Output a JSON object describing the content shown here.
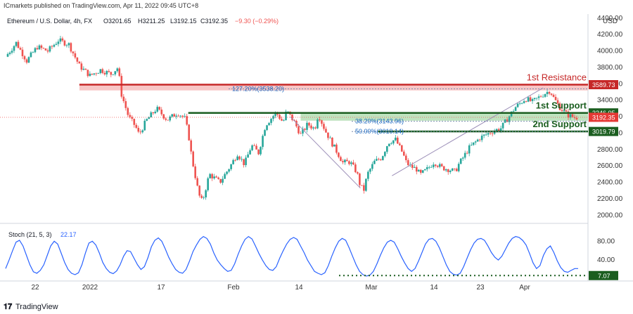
{
  "header": {
    "publisher": "ICmarkets published on TradingView.com, Apr 11, 2022 09:45 UTC+8",
    "symbol": "Ethereum / U.S. Dollar, 4h, FX",
    "open": "O3201.65",
    "high": "H3211.25",
    "low": "L3192.15",
    "close": "C3192.35",
    "change": "−9.30 (−0.29%)"
  },
  "footer": {
    "brand": "TradingView"
  },
  "chart_data": [
    {
      "type": "candlestick",
      "symbol": "Ethereum / U.S. Dollar",
      "interval": "4h",
      "currency": "USD",
      "ylim": [
        1900,
        4450
      ],
      "y_ticks": [
        "4400.00",
        "4200.00",
        "4000.00",
        "3800.00",
        "3600.00",
        "3400.00",
        "3200.00",
        "3000.00",
        "2800.00",
        "2600.00",
        "2400.00",
        "2200.00",
        "2000.00"
      ],
      "x_ticks": [
        "22",
        "2022",
        "17",
        "Feb",
        "14",
        "Mar",
        "14",
        "23",
        "Apr"
      ],
      "price_path": [
        [
          0,
          3930
        ],
        [
          3,
          4100
        ],
        [
          6,
          3880
        ],
        [
          9,
          4050
        ],
        [
          12,
          4000
        ],
        [
          15,
          4130
        ],
        [
          18,
          4080
        ],
        [
          21,
          3820
        ],
        [
          24,
          3700
        ],
        [
          27,
          3770
        ],
        [
          30,
          3720
        ],
        [
          32,
          3800
        ],
        [
          33,
          3470
        ],
        [
          35,
          3200
        ],
        [
          37,
          3080
        ],
        [
          38,
          2980
        ],
        [
          40,
          3150
        ],
        [
          43,
          3300
        ],
        [
          46,
          3160
        ],
        [
          49,
          3250
        ],
        [
          51,
          3180
        ],
        [
          52,
          3000
        ],
        [
          53,
          2700
        ],
        [
          55,
          2250
        ],
        [
          56,
          2160
        ],
        [
          58,
          2500
        ],
        [
          61,
          2400
        ],
        [
          64,
          2600
        ],
        [
          66,
          2750
        ],
        [
          68,
          2620
        ],
        [
          70,
          2850
        ],
        [
          72,
          2760
        ],
        [
          74,
          3100
        ],
        [
          77,
          3250
        ],
        [
          79,
          3130
        ],
        [
          80,
          3270
        ],
        [
          82,
          3150
        ],
        [
          84,
          2980
        ],
        [
          86,
          3110
        ],
        [
          88,
          3050
        ],
        [
          89,
          3230
        ],
        [
          91,
          3030
        ],
        [
          93,
          2870
        ],
        [
          95,
          2720
        ],
        [
          96,
          2640
        ],
        [
          98,
          2650
        ],
        [
          100,
          2520
        ],
        [
          101,
          2350
        ],
        [
          102,
          2310
        ],
        [
          103,
          2500
        ],
        [
          105,
          2650
        ],
        [
          107,
          2700
        ],
        [
          109,
          2890
        ],
        [
          111,
          2920
        ],
        [
          113,
          2760
        ],
        [
          114,
          2650
        ],
        [
          115,
          2600
        ],
        [
          117,
          2560
        ],
        [
          118,
          2490
        ],
        [
          120,
          2560
        ],
        [
          122,
          2650
        ],
        [
          124,
          2580
        ],
        [
          126,
          2560
        ],
        [
          128,
          2530
        ],
        [
          129,
          2620
        ],
        [
          132,
          2820
        ],
        [
          135,
          2940
        ],
        [
          138,
          3010
        ],
        [
          141,
          3060
        ],
        [
          143,
          3180
        ],
        [
          145,
          3310
        ],
        [
          148,
          3420
        ],
        [
          150,
          3380
        ],
        [
          153,
          3470
        ],
        [
          155,
          3520
        ],
        [
          156,
          3430
        ],
        [
          158,
          3300
        ],
        [
          160,
          3220
        ],
        [
          162,
          3190
        ],
        [
          163,
          3192.35
        ]
      ],
      "overlays": [
        {
          "type": "zone",
          "label": "1st Resistance",
          "value": 3589.73,
          "from_x": 21
        },
        {
          "type": "zone",
          "label": "1st Support",
          "value": 3246.05,
          "from_x": 52
        },
        {
          "type": "line",
          "label": "2nd Support",
          "value": 3019.79,
          "from_x": 106
        },
        {
          "type": "fib_level",
          "label": "127.20%(3538.20)",
          "value": 3538.2
        },
        {
          "type": "fib_level",
          "label": "38.20%(3143.96)",
          "value": 3143.96
        },
        {
          "type": "fib_level",
          "label": "50.00%(3019.14)",
          "value": 3019.14
        },
        {
          "type": "close_line",
          "value": 3192.35
        }
      ],
      "trendlines": [
        {
          "points": [
            [
              81,
              3200
            ],
            [
              101,
              2330
            ]
          ]
        },
        {
          "points": [
            [
              110,
              2480
            ],
            [
              153,
              3550
            ]
          ]
        }
      ],
      "price_tags": [
        {
          "value": 3589.73,
          "label": "3589.73",
          "color": "#c62828"
        },
        {
          "value": 3246.05,
          "label": "3246.05",
          "color": "#1b5e20"
        },
        {
          "value": 3192.35,
          "label": "3192.35",
          "color": "#e53935"
        },
        {
          "value": 3019.79,
          "label": "3019.79",
          "color": "#1b5e20"
        }
      ],
      "colors": {
        "up": "#26a69a",
        "down": "#ef5350",
        "resistance": "#c62828",
        "resistance_zone": "#f8c6c6",
        "support": "#1b5e20",
        "support_zone": "#bfe3bf",
        "fib": "#7b8eb0",
        "fib_label": "#1565c0"
      }
    },
    {
      "type": "line",
      "indicator": "Stoch",
      "params": "(21, 5, 3)",
      "value": 22.17,
      "ylim": [
        0,
        100
      ],
      "y_ticks": [
        "80.00",
        "40.00"
      ],
      "marker": {
        "value": 7.07,
        "label": "7.07",
        "color": "#1b5e20"
      },
      "color": "#2962ff",
      "values": [
        22,
        40,
        60,
        78,
        82,
        70,
        50,
        30,
        15,
        12,
        18,
        30,
        50,
        70,
        80,
        74,
        55,
        35,
        20,
        12,
        9,
        13,
        30,
        55,
        76,
        80,
        72,
        55,
        35,
        22,
        14,
        11,
        17,
        30,
        48,
        60,
        58,
        44,
        30,
        20,
        26,
        45,
        68,
        82,
        87,
        80,
        64,
        46,
        32,
        20,
        14,
        12,
        20,
        38,
        58,
        72,
        84,
        90,
        86,
        74,
        55,
        40,
        30,
        22,
        16,
        18,
        32,
        52,
        70,
        84,
        90,
        85,
        70,
        54,
        40,
        28,
        20,
        18,
        26,
        44,
        60,
        74,
        84,
        88,
        84,
        70,
        56,
        40,
        28,
        16,
        12,
        9,
        13,
        28,
        48,
        66,
        80,
        86,
        82,
        66,
        48,
        30,
        16,
        9,
        6,
        8,
        16,
        32,
        50,
        66,
        78,
        82,
        78,
        64,
        48,
        34,
        22,
        16,
        22,
        38,
        56,
        74,
        84,
        86,
        80,
        66,
        48,
        30,
        16,
        10,
        8,
        12,
        26,
        44,
        62,
        76,
        84,
        86,
        82,
        70,
        56,
        46,
        40,
        48,
        62,
        76,
        86,
        90,
        88,
        82,
        72,
        54,
        34,
        22,
        28,
        50,
        64,
        70,
        56,
        38,
        24,
        16,
        14,
        18,
        22,
        22
      ]
    }
  ]
}
